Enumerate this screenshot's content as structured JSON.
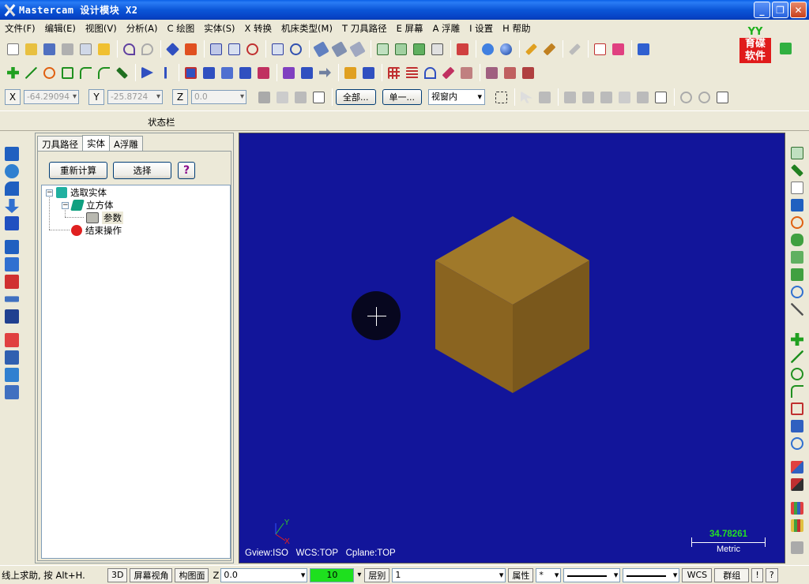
{
  "window": {
    "title": "Mastercam 设计模块  X2",
    "buttons": [
      "_",
      "❐",
      "✕"
    ]
  },
  "menu": [
    "文件(F)",
    "编辑(E)",
    "视图(V)",
    "分析(A)",
    "C 绘图",
    "实体(S)",
    "X 转换",
    "机床类型(M)",
    "T 刀具路径",
    "E 屏幕",
    "A 浮雕",
    "I 设置",
    "H 帮助"
  ],
  "brand": {
    "top": "YY",
    "text": "育碟\n软件"
  },
  "coords": {
    "x_label": "X",
    "x_value": "-64.29094",
    "y_label": "Y",
    "y_value": "-25.8724",
    "z_label": "Z",
    "z_value": "0.0"
  },
  "selection": {
    "all_button": "全部...",
    "single_button": "单一...",
    "mode": "视窗内"
  },
  "status_row_label": "状态栏",
  "panel": {
    "tabs": [
      "刀具路径",
      "实体",
      "A浮雕"
    ],
    "active_tab": "实体",
    "recalc_button": "重新计算",
    "select_button": "选择",
    "help_button": "?",
    "tree": {
      "root": "选取实体",
      "child": "立方体",
      "param": "参数",
      "end": "结束操作"
    }
  },
  "viewport": {
    "gview": "Gview:ISO",
    "wcs": "WCS:TOP",
    "cplane": "Cplane:TOP",
    "scale_value": "34.78261",
    "scale_unit": "Metric",
    "axis_y": "Y",
    "axis_x": "X",
    "bg_color": "#12159a",
    "cube_colors": [
      "#a0792a",
      "#8a6420",
      "#7a581c"
    ]
  },
  "bottombar": {
    "hint": "线上求助, 按 Alt+H.",
    "btn_3d": "3D",
    "btn_screen_view": "屏幕视角",
    "btn_plane": "构图面",
    "z_label": "Z",
    "z_value": "0.0",
    "color_value": "10",
    "layer_label": "层别",
    "layer_value": "1",
    "attr_button": "属性",
    "point_style": "*",
    "wcs_button": "WCS",
    "group_button": "群组",
    "extra1": "!",
    "extra2": "?"
  }
}
